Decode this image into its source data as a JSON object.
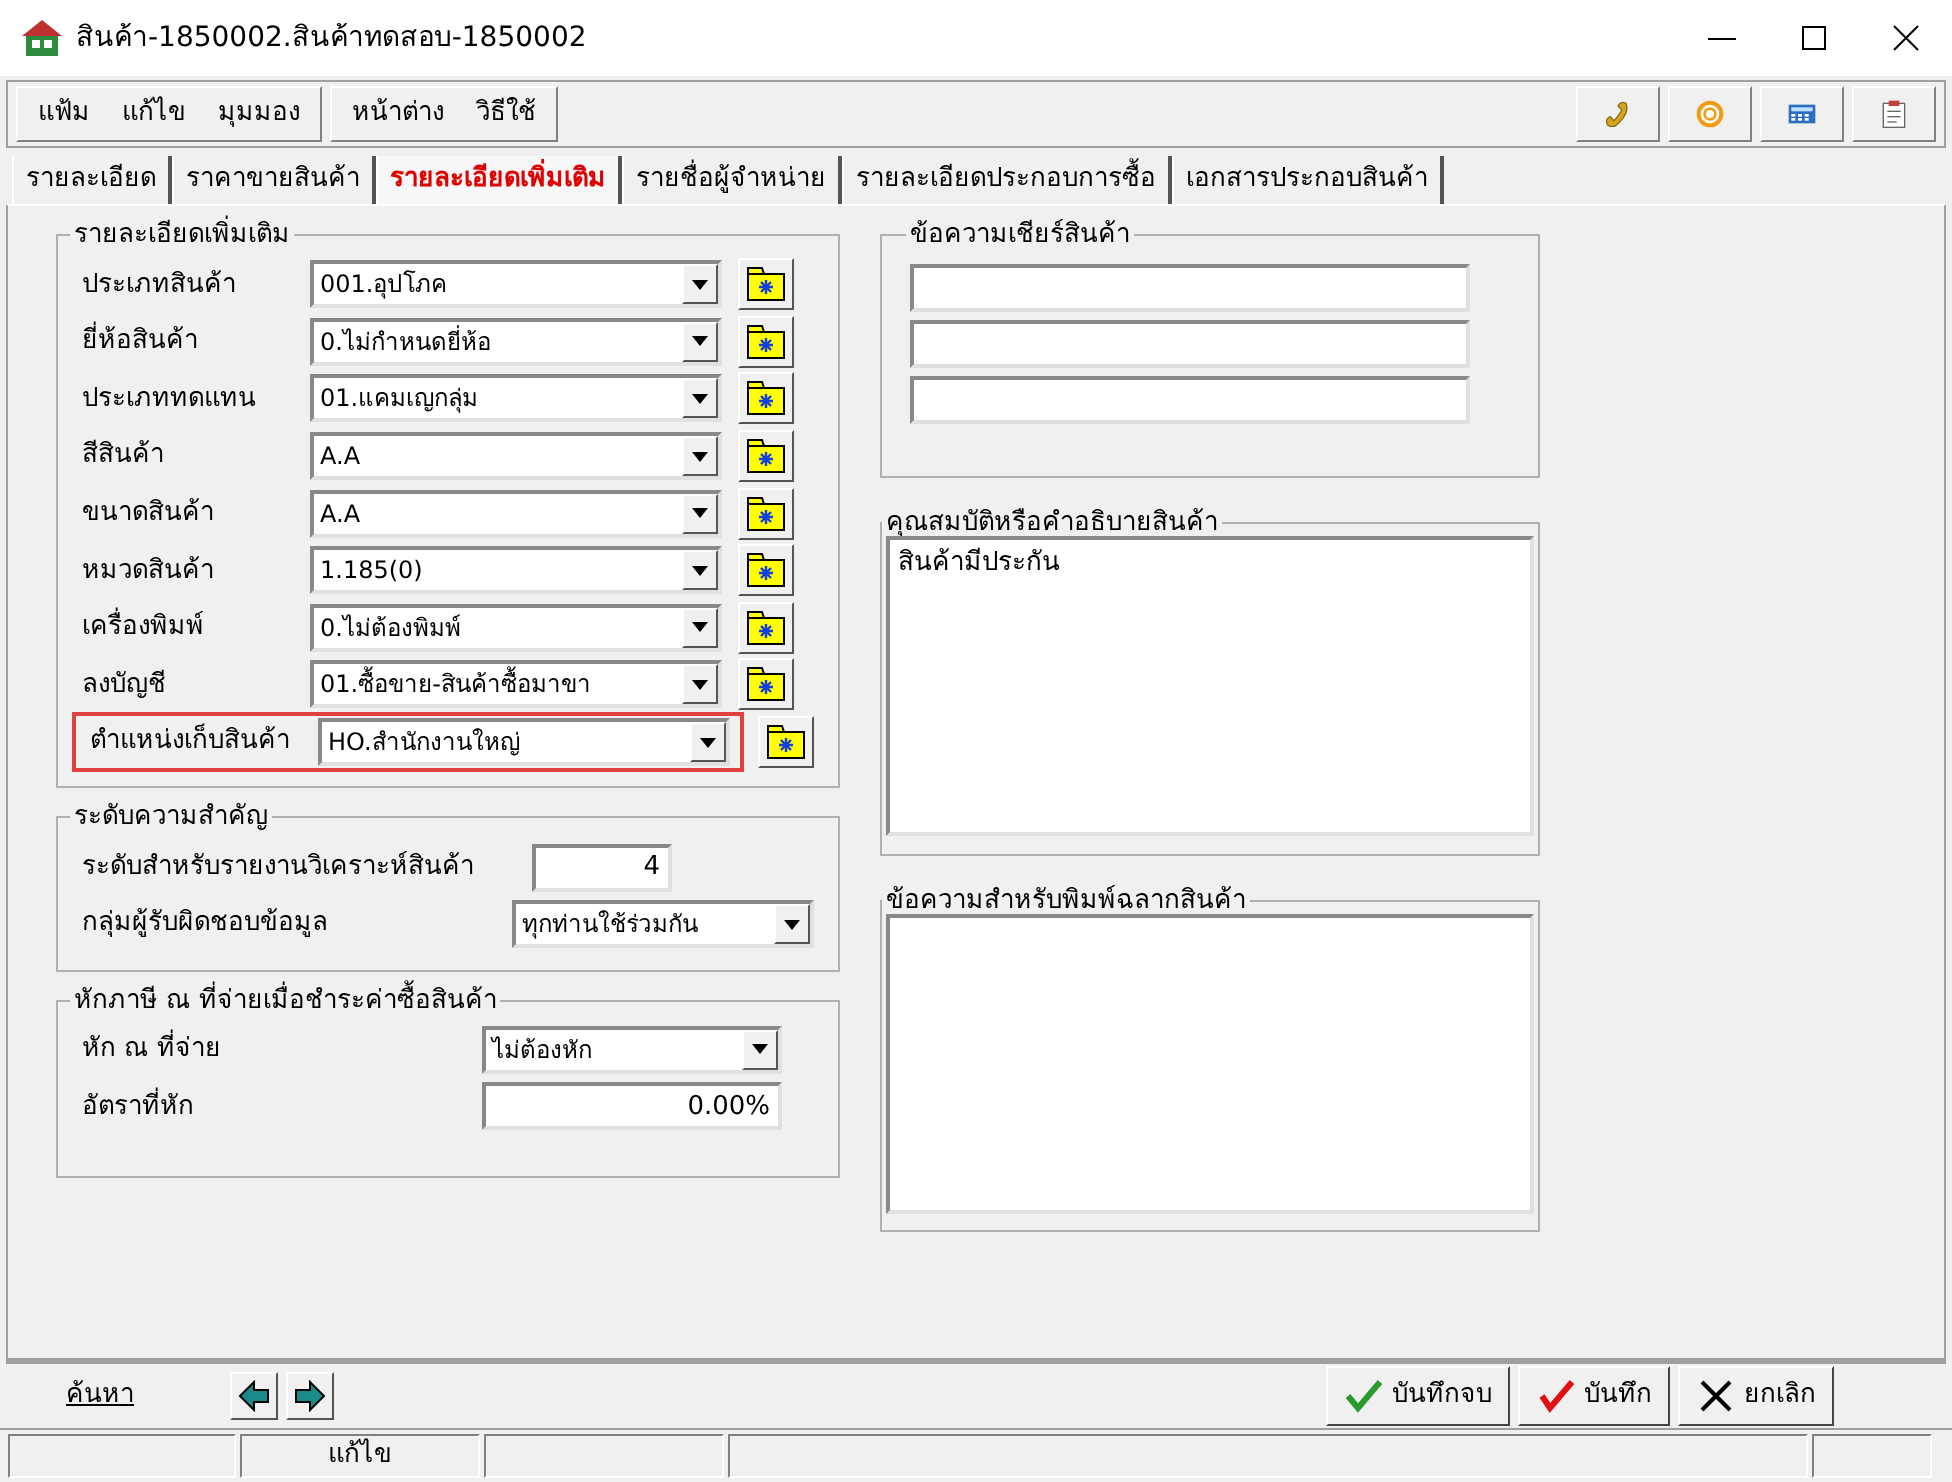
{
  "window": {
    "title": "สินค้า-1850002.สินค้าทดสอบ-1850002"
  },
  "menu_groups": [
    {
      "items": [
        "แฟ้ม",
        "แก้ไข",
        "มุมมอง"
      ]
    },
    {
      "items": [
        "หน้าต่าง",
        "วิธีใช้"
      ]
    }
  ],
  "toolbar": [
    {
      "kind": "handset"
    },
    {
      "kind": "target"
    },
    {
      "kind": "calculator"
    },
    {
      "kind": "clipboard"
    }
  ],
  "tabs": [
    {
      "label": "รายละเอียด",
      "selected": false
    },
    {
      "label": "ราคาขายสินค้า",
      "selected": false
    },
    {
      "label": "รายละเอียดเพิ่มเติม",
      "selected": true
    },
    {
      "label": "รายชื่อผู้จำหน่าย",
      "selected": false
    },
    {
      "label": "รายละเอียดประกอบการซื้อ",
      "selected": false
    },
    {
      "label": "เอกสารประกอบสินค้า",
      "selected": false
    }
  ],
  "details": {
    "title": "รายละเอียดเพิ่มเติม",
    "fields": [
      {
        "label": "ประเภทสินค้า",
        "value": "001.อุปโภค",
        "highlighted": false
      },
      {
        "label": "ยี่ห้อสินค้า",
        "value": "0.ไม่กำหนดยี่ห้อ",
        "highlighted": false
      },
      {
        "label": "ประเภททดแทน",
        "value": "01.แคมเญกลุ่ม",
        "highlighted": false
      },
      {
        "label": "สีสินค้า",
        "value": "A.A",
        "highlighted": false
      },
      {
        "label": "ขนาดสินค้า",
        "value": "A.A",
        "highlighted": false
      },
      {
        "label": "หมวดสินค้า",
        "value": "1.185(0)",
        "highlighted": false
      },
      {
        "label": "เครื่องพิมพ์",
        "value": "0.ไม่ต้องพิมพ์",
        "highlighted": false
      },
      {
        "label": "ลงบัญชี",
        "value": "01.ซื้อขาย-สินค้าซื้อมาขา",
        "highlighted": false
      },
      {
        "label": "ตำแหน่งเก็บสินค้า",
        "value": "HO.สำนักงานใหญ่",
        "highlighted": true
      }
    ]
  },
  "importance": {
    "title": "ระดับความสำคัญ",
    "rows": [
      {
        "kind": "number",
        "label": "ระดับสำหรับรายงานวิเคราะห์สินค้า",
        "value": "4"
      },
      {
        "kind": "select",
        "label": "กลุ่มผู้รับผิดชอบข้อมูล",
        "value": "ทุกท่านใช้ร่วมกัน"
      }
    ]
  },
  "withholding": {
    "title": "หักภาษี ณ ที่จ่ายเมื่อชำระค่าซื้อสินค้า",
    "rows": [
      {
        "kind": "select",
        "label": "หัก ณ ที่จ่าย",
        "value": "ไม่ต้องหัก"
      },
      {
        "kind": "number",
        "label": "อัตราที่หัก",
        "value": "0.00%"
      }
    ]
  },
  "cheer": {
    "title": "ข้อความเชียร์สินค้า",
    "lines": [
      {
        "kind": "text"
      },
      {
        "kind": "text"
      },
      {
        "kind": "text"
      }
    ]
  },
  "description": {
    "title": "คุณสมบัติหรือคำอธิบายสินค้า",
    "value": "สินค้ามีประกัน"
  },
  "label_text": {
    "title": "ข้อความสำหรับพิมพ์ฉลากสินค้า"
  },
  "footer": {
    "search_link": "ค้นหา",
    "buttons": [
      {
        "kind": "save_close",
        "label": "บันทึกจบ"
      },
      {
        "kind": "save",
        "label": "บันทึก"
      },
      {
        "kind": "cancel",
        "label": "ยกเลิก"
      }
    ]
  },
  "status_bar": {
    "mode": "แก้ไข"
  }
}
